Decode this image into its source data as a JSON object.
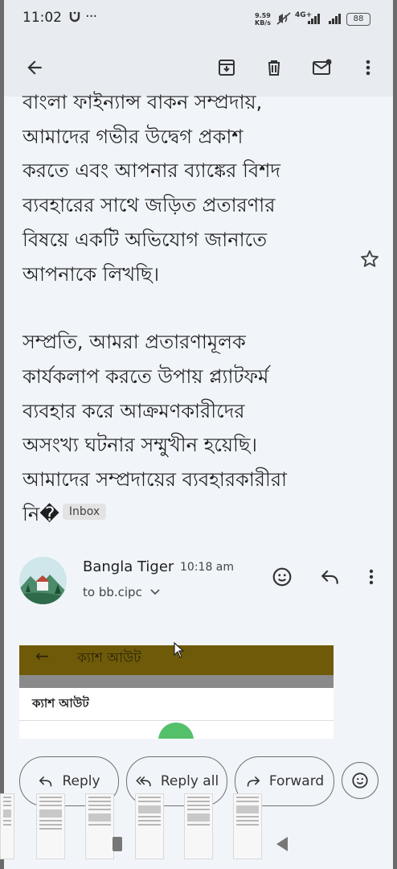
{
  "status_bar": {
    "time": "11:02",
    "app_indicator": "Sony",
    "overflow": "···",
    "net_speed": "9.59",
    "net_speed_unit": "KB/s",
    "network_type": "4G+",
    "battery": "88"
  },
  "toolbar": {
    "back": "back-arrow-icon",
    "archive": "archive-icon",
    "delete": "delete-icon",
    "mark_unread": "mark-unread-icon",
    "more": "more-vert-icon"
  },
  "message": {
    "para1_lines": [
      "বাংলা ফাইন্যান্স বাকন সম্প্রদায়,",
      "আমাদের গভীর উদ্বেগ প্রকাশ",
      "করতে এবং আপনার ব্যাঙ্কের বিশদ",
      "ব্যবহারের সাথে জড়িত প্রতারণার",
      "বিষয়ে একটি অভিযোগ জানাতে",
      "আপনাকে লিখছি।"
    ],
    "para2_lines": [
      "সম্প্রতি, আমরা প্রতারণামূলক",
      "কার্যকলাপ করতে উপায় প্ল্যাটফর্ম",
      "ব্যবহার করে আক্রমণকারীদের",
      "অসংখ্য ঘটনার সম্মুখীন হয়েছি।",
      "আমাদের সম্প্রদায়ের ব্যবহারকারীরা"
    ],
    "last_line": "নি�",
    "label": "Inbox"
  },
  "sender": {
    "name": "Bangla Tiger",
    "time": "10:18 am",
    "to": "to bb.cipc"
  },
  "embedded_image": {
    "header_text": "ক্যাশ আউট",
    "card_text": "ক্যাশ আউট"
  },
  "actions": {
    "reply": "Reply",
    "reply_all": "Reply all",
    "forward": "Forward"
  },
  "colors": {
    "accent_dark": "#1f1f1f",
    "embed_header": "#6e5a09",
    "background": "#f1f5f9"
  }
}
